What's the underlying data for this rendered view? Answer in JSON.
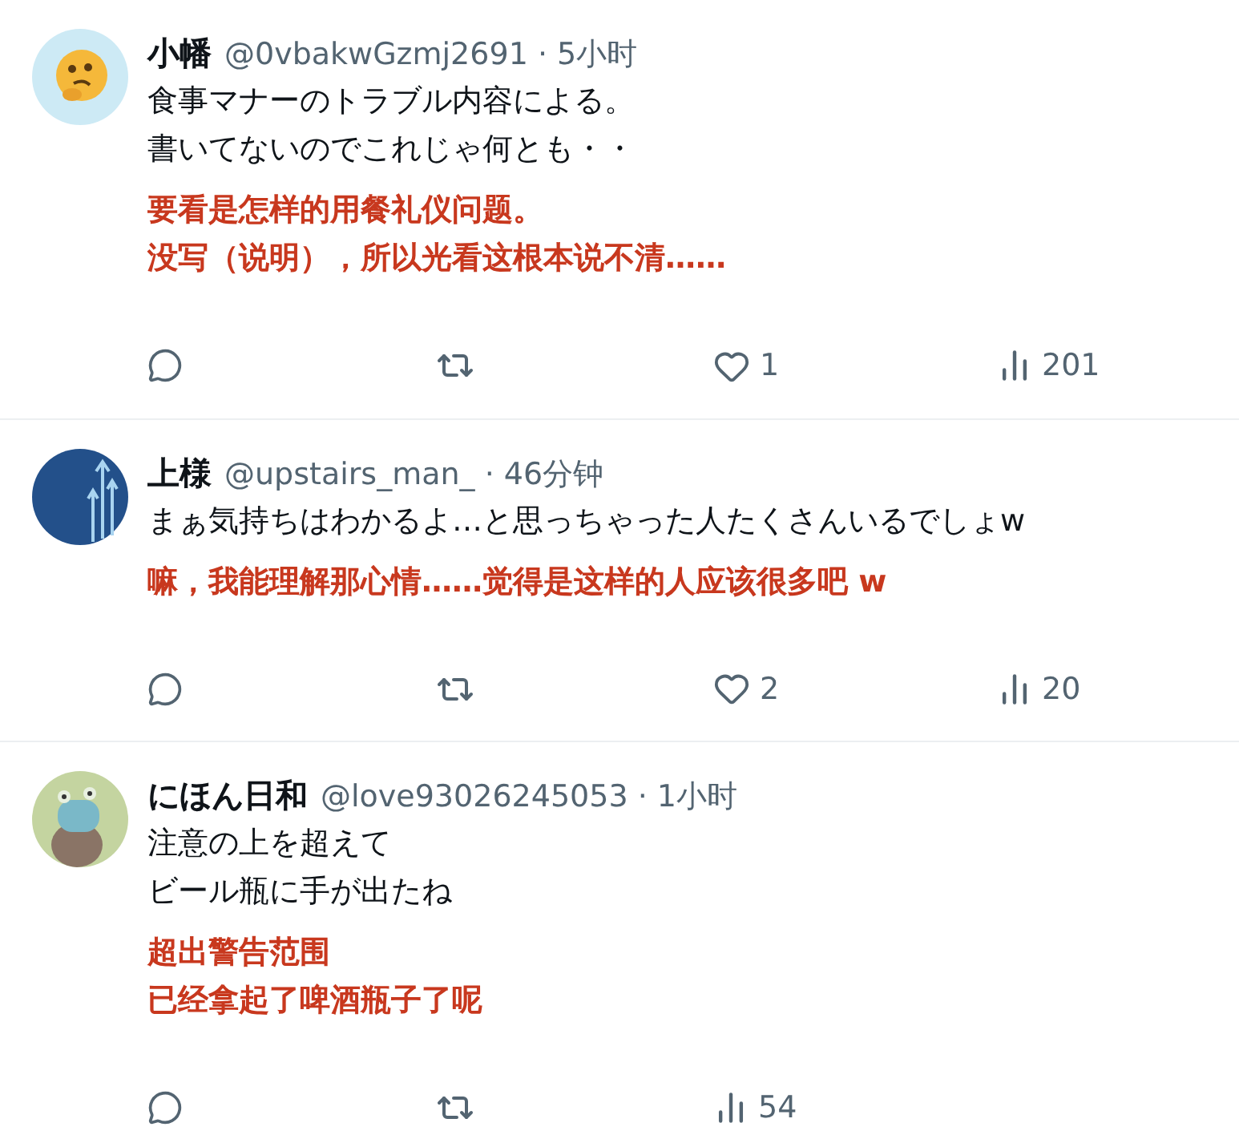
{
  "posts": [
    {
      "name": "小幡",
      "meta": "@0vbakwGzmj2691 · 5小时",
      "avatar": {
        "kind": "thinking"
      },
      "text": [
        "食事マナーのトラブル内容による。",
        "書いてないのでこれじゃ何とも・・"
      ],
      "translation": [
        "要看是怎样的用餐礼仪问题。",
        "没写（说明），所以光看这根本说不清……"
      ],
      "actions": [
        {
          "kind": "reply"
        },
        {
          "kind": "retweet"
        },
        {
          "kind": "like",
          "count": "1"
        },
        {
          "kind": "views",
          "count": "201"
        }
      ]
    },
    {
      "name": "上様",
      "meta": "@upstairs_man_ · 46分钟",
      "avatar": {
        "kind": "arrows"
      },
      "text": [
        "まぁ気持ちはわかるよ…と思っちゃった人たくさんいるでしょw"
      ],
      "translation": [
        "嘛，我能理解那心情……觉得是这样的人应该很多吧 w"
      ],
      "actions": [
        {
          "kind": "reply"
        },
        {
          "kind": "retweet"
        },
        {
          "kind": "like",
          "count": "2"
        },
        {
          "kind": "views",
          "count": "20"
        }
      ]
    },
    {
      "name": "にほん日和",
      "meta": "@love93026245053 · 1小时",
      "avatar": {
        "kind": "creature"
      },
      "text": [
        "注意の上を超えて",
        "ビール瓶に手が出たね"
      ],
      "translation": [
        "超出警告范围",
        "已经拿起了啤酒瓶子了呢"
      ],
      "actions": [
        {
          "kind": "reply"
        },
        {
          "kind": "retweet"
        },
        {
          "kind": "views",
          "count": "54"
        }
      ]
    }
  ]
}
